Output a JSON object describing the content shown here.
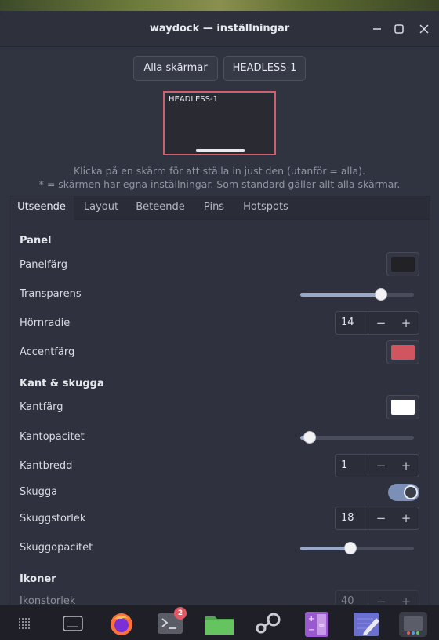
{
  "window": {
    "title": "waydock — inställningar",
    "minimize_icon": "minimize-icon",
    "maximize_icon": "maximize-icon",
    "close_icon": "close-icon"
  },
  "screens": {
    "all_label": "Alla skärmar",
    "headless_label": "HEADLESS-1",
    "preview_label": "HEADLESS-1"
  },
  "hints": {
    "line1": "Klicka på en skärm för att ställa in just den (utanför = alla).",
    "line2": "* = skärmen har egna inställningar. Som standard gäller allt alla skärmar."
  },
  "tabs": [
    "Utseende",
    "Layout",
    "Beteende",
    "Pins",
    "Hotspots"
  ],
  "settings": {
    "panel_section": "Panel",
    "panel_color_label": "Panelfärg",
    "panel_color": "#222226",
    "transparency_label": "Transparens",
    "transparency_value": 0.71,
    "corner_radius_label": "Hörnradie",
    "corner_radius_value": "14",
    "accent_color_label": "Accentfärg",
    "accent_color": "#d0555f",
    "border_section": "Kant & skugga",
    "border_color_label": "Kantfärg",
    "border_color": "#ffffff",
    "border_opacity_label": "Kantopacitet",
    "border_opacity_value": 0.08,
    "border_width_label": "Kantbredd",
    "border_width_value": "1",
    "shadow_label": "Skugga",
    "shadow_on": true,
    "shadow_size_label": "Skuggstorlek",
    "shadow_size_value": "18",
    "shadow_opacity_label": "Skuggopacitet",
    "shadow_opacity_value": 0.44,
    "icons_section": "Ikoner",
    "icon_size_label": "Ikonstorlek",
    "icon_size_value": "40",
    "minus": "−",
    "plus": "+"
  },
  "dock": {
    "items": [
      "app-grid-icon",
      "keyboard-icon",
      "firefox-icon",
      "terminal-icon",
      "files-icon",
      "steam-icon",
      "calculator-icon",
      "text-editor-icon",
      "settings-app-icon"
    ],
    "terminal_badge": "2"
  }
}
